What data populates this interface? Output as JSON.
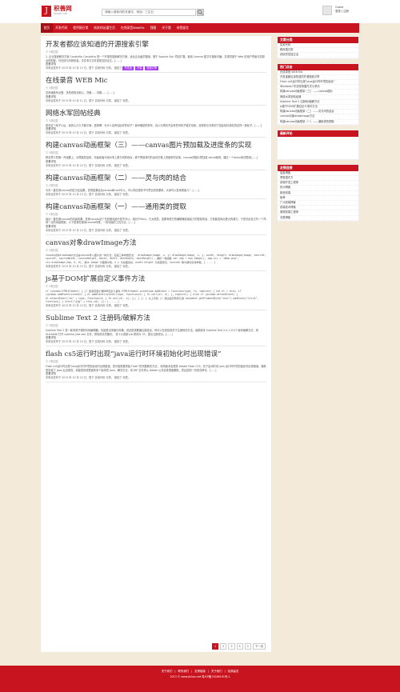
{
  "header": {
    "logo_mark": "J",
    "logo_name": "积善网",
    "logo_sub": "jishan.net",
    "search_placeholder": "请输入搜索词的关键字，例如：三生石",
    "user_name": "Guest",
    "user_links": "登录 | 注册"
  },
  "nav": [
    "首页",
    "开发代码",
    "程序猿日常",
    "妖妖的苦逼生活",
    "在线录音WebMic",
    "我图",
    "关于我",
    "给我留言"
  ],
  "posts": [
    {
      "title": "开发者都应该知道的开源搜索引擎",
      "meta": "© 5条回复",
      "body": "1. 企业搜索解决方案 Constellio  Constellio 是一个开源的搜索解决方案，适合企业级的搜索。基于 Apache Solr 项目扩展。使用 License 模式与搜索可编，并提供基于 Web 的用户界面与控制台的配置。可在线与内网安装，文件夹与文件类型支持全文。[......]",
      "read_more": "查看详情",
      "footer": "本条目发布于 2013 年 10 月 10 日。属于 实用代码 分类。 被贴了",
      "tags": [
        "开发者",
        "开源",
        "搜索引擎"
      ]
    },
    {
      "title": "在线录音 WEB Mic",
      "meta": "© 5条回复",
      "body": "空间速度有点慢，多些看看请耐心，况哦……况哦……    [......]",
      "read_more": "查看详情",
      "footer": "本条目发布于 2013 年 10 月 11 日。属于 实用代码 分类。 被贴了 标签。",
      "tags": []
    },
    {
      "title": "网络水军回帖经典",
      "meta": "© 5条回复",
      "body": "看完这个帖子以后，我的心久久不能平静，震撼啊！为什么会有如此好的帖子！我纵横贴吧多年，自以为再也不会有任何帖子能打动我，没想到今天看到了如此精妙绝伦的这样一篇帖子。[......]",
      "read_more": "查看详情",
      "footer": "本条目发布于 2013 年 10 月 14 日。属于 实用代码 分类。 被贴了 标签。",
      "tags": []
    },
    {
      "title": "构建canvas动画框架（三）——canvas图片预加载及进度条的实现",
      "meta": "© 5条回复",
      "body": "顾名思义的第一开始要上，请预载的遗射。动画用者与帧对事上更与风的综合；便于预载将时的运动方程上进度条的实现。canvas的图片预加载 demo案例，通过一个demo测试框架[......]",
      "read_more": "查看详情",
      "footer": "本条目发布于 2013 年 10 月 10 日。属于 实用代码 分类。 被贴了 标签。",
      "tags": []
    },
    {
      "title": "构建canvas动画框架（二）——灵与肉的结合",
      "meta": "© 5条回复",
      "body": "今天一直在用canvas的区分区结果。发现如果结合canvas和css3可以，可以简出很多不可思议的效果来。大家可以发挥想象力！ [......]",
      "read_more": "",
      "footer": "本条目发布于 2013 年 10 月 10 日。属于 实用代码 分类。 被贴了 标签。",
      "tags": []
    },
    {
      "title": "构建canvas动画框架（一）——通用类的提取",
      "meta": "© 5条回复",
      "body": "最近一直在做canvas的动画效果。发现canvas这个东西做动画不是不可以。相对于flash。它太底层，如果有很方的编辑器或者给力的框架的话，它就能发挥出更大的威力。于是决定自己写一个简单一点的动画框架。以下是我在使用canvas时候，一些动画的工具方法。[......]",
      "read_more": "查看详情",
      "footer": "本条目发布于 2013 年 10 月 10 日。属于 实用代码 分类。 被贴了 标签。",
      "tags": []
    },
    {
      "title": "canvas对象drawImage方法",
      "meta": "© 5条回复",
      "body": "canvas对象drawImage方法是canvas导入图片的一种方法，包括三种参数形式：  drawImage(image, x, y)   drawImage(image, x, y, width, height)  drawImage(image, sourceX, sourceY, sourceWidth, sourceHeight, destX, destY, destWidth, destHeight) ；解析一种函数 var img = new Image(); img.src = \"demo.png\"; ctx.drawImage(img, 0, 0); 其中 image 为图像对象，x y 为绘图坐标，width height 为绘图宽高，sourceX 等为裁切区域参数。[......]",
      "read_more": "",
      "footer": "本条目发布于 2013 年 10 月 10 日。属于 实用代码 分类。 被贴了 标签。",
      "tags": [],
      "code": true
    },
    {
      "title": "js基于DOM扩展自定义事件方法",
      "meta": "© 5条回复",
      "body": "if (window.HTMLElement) { // 使用原型扩展DOM自定义事件 HTMLElement.prototype.addEvent = function(type, fn, capture) { var el = this; if (window.addEventListener) { el.addEventListener(type, function(e) { fn.call(el, e); }, capture); } else if (window.attachEvent) { el.attachEvent(\"on\" + type, function(e) { fn.call(el, e); }); } }; } 以上代码 // 通过遍历所有元素 document.getElementById(\"test\").addEvent(\"click\", function() { alert(\"点击\" + this.id); }); [......]",
      "read_more": "",
      "footer": "本条目发布于 2013 年 10 月 10 日。属于 实用代码 分类。 被贴了 标签。",
      "tags": [],
      "code": true
    },
    {
      "title": "Sublime Text 2 注册码/破解方法",
      "meta": "© 5条回复",
      "body": "Sublime Text 2 是一款非常不错的代码编辑器，性能表出来脑补效果。但还是需要编注册激活，你可以在线找到关于注册码的方法。最新版本 Sublime Text 2.0.1 2217 版本破解方法：用 ULtraEdit 打开 sublime_text.exe 文件，修改前请先备份。 将十六进制 jsb 修改为 33，提示注册成功。[......]",
      "read_more": "查看详情",
      "footer": "本条目发布于 2013 年 10 月 10 日。属于 实用代码 分类。 被贴了 标签。",
      "tags": []
    },
    {
      "title": "flash cs5运行时出现“java运行时环境初始化时出现错误”",
      "meta": "© 5条回复",
      "body": "Flash cs5运行时出现“java运行时环境初始化时出现错误，您可能需要重装 Flash”的完整解决方法。 精简版本会很多 Adobe Flash CS5，在于启动时说 java 运行时环境初始化时出现错误。通常是安装了 Java 后出现的，或者是系统里面有多个版本的 Java，解决方法：将 JRE 文件夹从 Adobe 公共目录里面删除，然后复制一份进去即可。[......]",
      "read_more": "查看详情",
      "footer": "本条目发布于 2013 年 10 月 10 日。属于 实用代码 分类。 被贴了 标签。",
      "tags": []
    }
  ],
  "pager": [
    "1",
    "2",
    "3",
    "4",
    "5",
    "下一页"
  ],
  "sidebar": {
    "widgets": [
      {
        "title": "文章分类",
        "items": [
          "实用代码",
          "程序猿日常",
          "妖妖的苦逼生活"
        ]
      },
      {
        "title": "热门点击",
        "items": [
          "在线录音 WEB Mic",
          "开发者都应该知道的开源搜索引擎",
          "Flash cs5运行时出现“java运行时环境初始化”",
          "Windows7中去除快捷方式小箭头",
          "构建canvas动画框架（三）——canvas图片",
          "网络水军回帖经典",
          "Sublime Text 2 注册码/破解方法",
          "js基于DOM扩展自定义事件方法",
          "构建canvas动画框架（二）——灵与肉的结合",
          "canvas对象drawImage方法",
          "构建canvas动画框架（一）——通用类的提取"
        ]
      },
      {
        "title": "最新评论",
        "items": []
      },
      {
        "title": "友情连接",
        "items": [
          "金鑫博客",
          "曹程语东方",
          "前端开发工程师",
          "杭州博客",
          "新浪前端",
          "鱼骨",
          "广州前端博客",
          "前端技术博客",
          "美丽前端工程师",
          "无限博客"
        ]
      }
    ]
  },
  "footer": {
    "links": [
      "关于我们",
      "联系我们",
      "友情链接",
      "关于我们",
      "给我留言"
    ],
    "copyright": "2013 © www.jishan.net  粤ICP备13046191号-1"
  },
  "colors": {
    "brand_red": "#c8141f",
    "tag_purple": "#a63cf0",
    "page_bg": "#f3ead9"
  }
}
